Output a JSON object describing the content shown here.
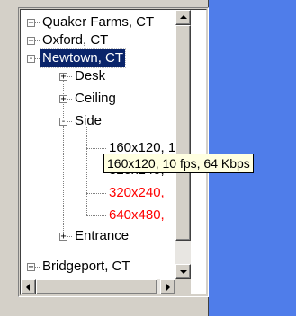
{
  "colors": {
    "desktop": "#4f7dea",
    "selection": "#0a246a",
    "highlight_text": "#ff0000",
    "tooltip_bg": "#ffffe1"
  },
  "tree": {
    "items": [
      {
        "label": "Quaker Farms, CT",
        "expander": "+",
        "state": "collapsed"
      },
      {
        "label": "Oxford, CT",
        "expander": "+",
        "state": "collapsed"
      },
      {
        "label": "Newtown, CT",
        "expander": "-",
        "state": "expanded",
        "selected": true
      },
      {
        "label": "Desk",
        "expander": "+",
        "state": "collapsed"
      },
      {
        "label": "Ceiling",
        "expander": "+",
        "state": "collapsed"
      },
      {
        "label": "Side",
        "expander": "-",
        "state": "expanded"
      },
      {
        "label": "160x120, 10 fps, 64 Kbps",
        "expander": "",
        "state": "leaf"
      },
      {
        "label": "320x240,",
        "expander": "",
        "state": "leaf"
      },
      {
        "label": "320x240,",
        "expander": "",
        "state": "leaf",
        "color": "red"
      },
      {
        "label": "640x480,",
        "expander": "",
        "state": "leaf",
        "color": "red"
      },
      {
        "label": "Entrance",
        "expander": "+",
        "state": "collapsed"
      },
      {
        "label": "Bridgeport, CT",
        "expander": "+",
        "state": "collapsed"
      }
    ]
  },
  "tooltip": {
    "text": "160x120, 10 fps, 64 Kbps"
  },
  "icons": {
    "scroll_up": "scroll-up-arrow-icon",
    "scroll_down": "scroll-down-arrow-icon",
    "scroll_left": "scroll-left-arrow-icon",
    "scroll_right": "scroll-right-arrow-icon"
  }
}
